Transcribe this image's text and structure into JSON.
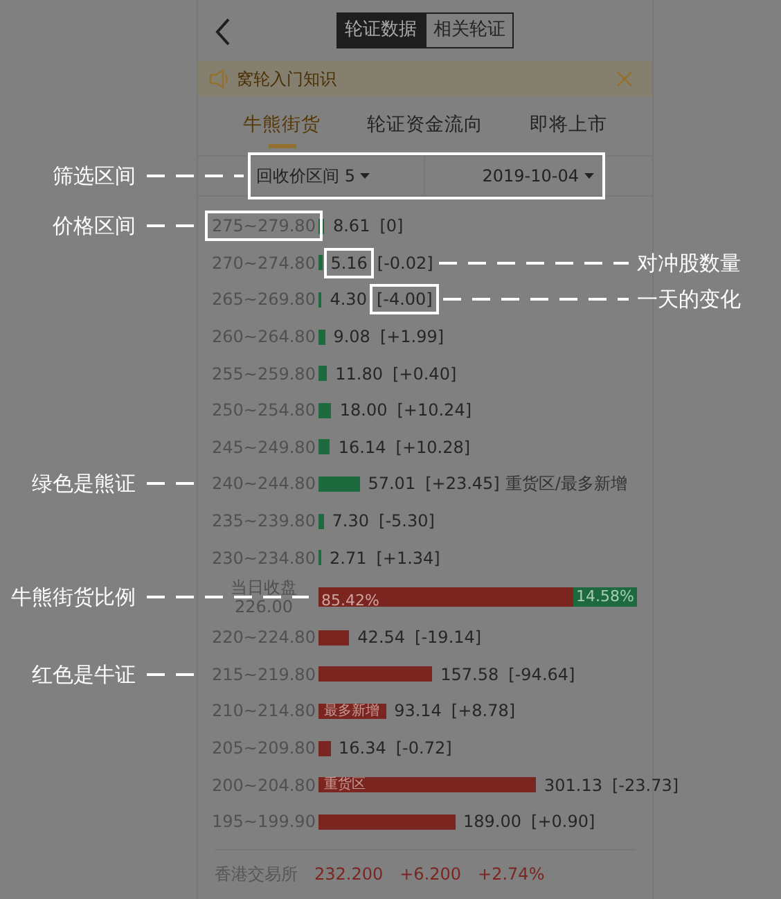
{
  "header": {
    "segments": [
      {
        "label": "轮证数据",
        "selected": true
      },
      {
        "label": "相关轮证",
        "selected": false
      }
    ]
  },
  "notice": {
    "text": "窝轮入门知识"
  },
  "tabs": [
    {
      "label": "牛熊街货",
      "selected": true
    },
    {
      "label": "轮证资金流向",
      "selected": false
    },
    {
      "label": "即将上市",
      "selected": false
    }
  ],
  "filter": {
    "range": "回收价区间 5",
    "date": "2019-10-04",
    "note": "筛选区间"
  },
  "rows": [
    {
      "kind": "bear",
      "range": "275~279.80",
      "value": "8.61",
      "change": "[0]",
      "note_range": "价格区间"
    },
    {
      "kind": "bear",
      "range": "270~274.80",
      "value": "5.16",
      "change": "[-0.02]",
      "note_value": "对冲股数量"
    },
    {
      "kind": "bear",
      "range": "265~269.80",
      "value": "4.30",
      "change": "[-4.00]",
      "note_change": "一天的变化"
    },
    {
      "kind": "bear",
      "range": "260~264.80",
      "value": "9.08",
      "change": "[+1.99]"
    },
    {
      "kind": "bear",
      "range": "255~259.80",
      "value": "11.80",
      "change": "[+0.40]"
    },
    {
      "kind": "bear",
      "range": "250~254.80",
      "value": "18.00",
      "change": "[+10.24]"
    },
    {
      "kind": "bear",
      "range": "245~249.80",
      "value": "16.14",
      "change": "[+10.28]"
    },
    {
      "kind": "bear",
      "range": "240~244.80",
      "value": "57.01",
      "change": "[+23.45]",
      "tag": "重货区/最多新增",
      "note_bar": "绿色是熊证"
    },
    {
      "kind": "bear",
      "range": "235~239.80",
      "value": "7.30",
      "change": "[-5.30]"
    },
    {
      "kind": "bear",
      "range": "230~234.80",
      "value": "2.71",
      "change": "[+1.34]"
    },
    {
      "kind": "ratio",
      "close_label": "当日收盘",
      "close_price": "226.00",
      "level": 0.8542,
      "bull_text": "85.42%",
      "bear_text": "14.58%",
      "note_bar": "牛熊街货比例"
    },
    {
      "kind": "bull",
      "range": "220~224.80",
      "value": "42.54",
      "change": "[-19.14]"
    },
    {
      "kind": "bull",
      "range": "215~219.80",
      "value": "157.58",
      "change": "[-94.64]",
      "note_bar": "红色是牛证"
    },
    {
      "kind": "bull",
      "range": "210~214.80",
      "value": "93.14",
      "change": "[+8.78]",
      "tag": "最多新增"
    },
    {
      "kind": "bull",
      "range": "205~209.80",
      "value": "16.34",
      "change": "[-0.72]"
    },
    {
      "kind": "bull",
      "range": "200~204.80",
      "value": "301.13",
      "change": "[-23.73]",
      "tag": "重货区"
    },
    {
      "kind": "bull",
      "range": "195~199.90",
      "value": "189.00",
      "change": "[+0.90]"
    }
  ],
  "footer": {
    "exchange": "香港交易所",
    "price": "232.200",
    "change": "+6.200",
    "percent": "+2.74%"
  }
}
